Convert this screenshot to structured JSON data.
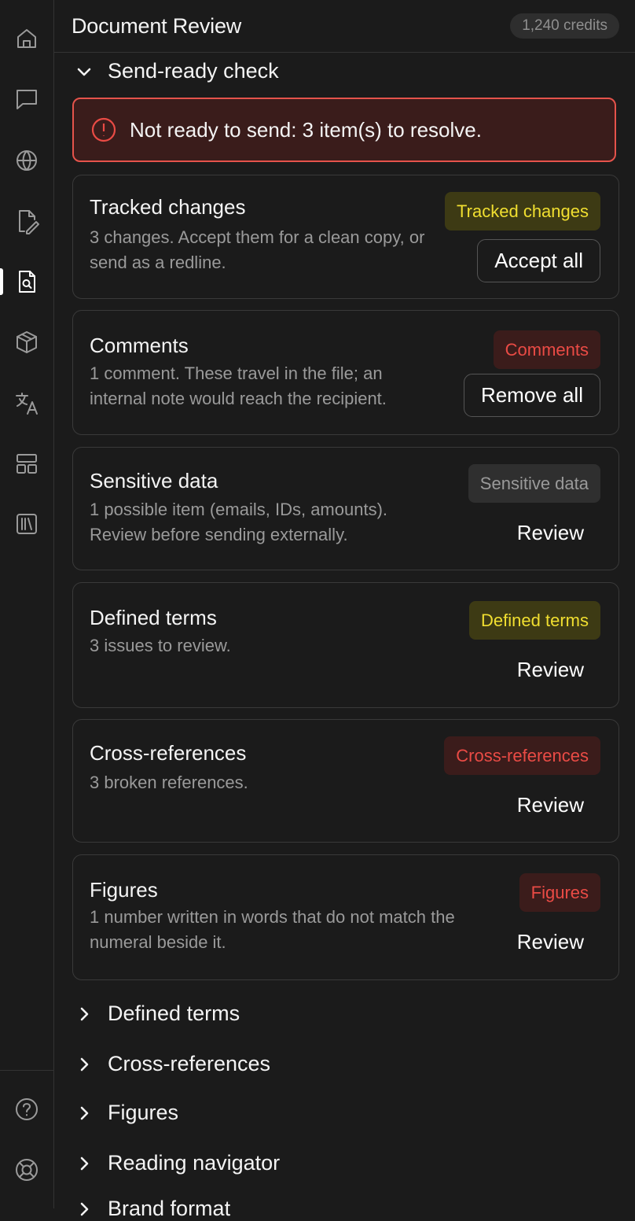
{
  "app": {
    "title": "Document Review",
    "credits": "1,240 credits"
  },
  "rail": {
    "items": [
      {
        "name": "home-icon"
      },
      {
        "name": "chat-icon"
      },
      {
        "name": "globe-icon"
      },
      {
        "name": "edit-document-icon"
      },
      {
        "name": "document-search-icon",
        "active": true
      },
      {
        "name": "cube-icon"
      },
      {
        "name": "translate-icon"
      },
      {
        "name": "layout-icon"
      },
      {
        "name": "library-icon"
      }
    ],
    "bottom": [
      {
        "name": "help-icon"
      },
      {
        "name": "support-icon"
      }
    ]
  },
  "send_ready": {
    "heading": "Send-ready check",
    "alert": "Not ready to send: 3 item(s) to resolve.",
    "cards": [
      {
        "title": "Tracked changes",
        "desc": "3 changes. Accept them for a clean copy, or send as a redline.",
        "badge": "Tracked changes",
        "badge_tone": "yellow",
        "action": "Accept all"
      },
      {
        "title": "Comments",
        "desc": "1 comment. These travel in the file; an internal note would reach the recipient.",
        "badge": "Comments",
        "badge_tone": "red",
        "action": "Remove all"
      },
      {
        "title": "Sensitive data",
        "desc": "1 possible item (emails, IDs, amounts). Review before sending externally.",
        "badge": "Sensitive data",
        "badge_tone": "gray",
        "action": "Review"
      },
      {
        "title": "Defined terms",
        "desc": "3 issues to review.",
        "badge": "Defined terms",
        "badge_tone": "yellow",
        "action": "Review"
      },
      {
        "title": "Cross-references",
        "desc": "3 broken references.",
        "badge": "Cross-references",
        "badge_tone": "red",
        "action": "Review"
      },
      {
        "title": "Figures",
        "desc": "1 number written in words that do not match the numeral beside it.",
        "badge": "Figures",
        "badge_tone": "red",
        "action": "Review"
      }
    ]
  },
  "sections": [
    {
      "label": "Defined terms"
    },
    {
      "label": "Cross-references"
    },
    {
      "label": "Figures"
    },
    {
      "label": "Reading navigator"
    },
    {
      "label": "Brand format"
    }
  ]
}
